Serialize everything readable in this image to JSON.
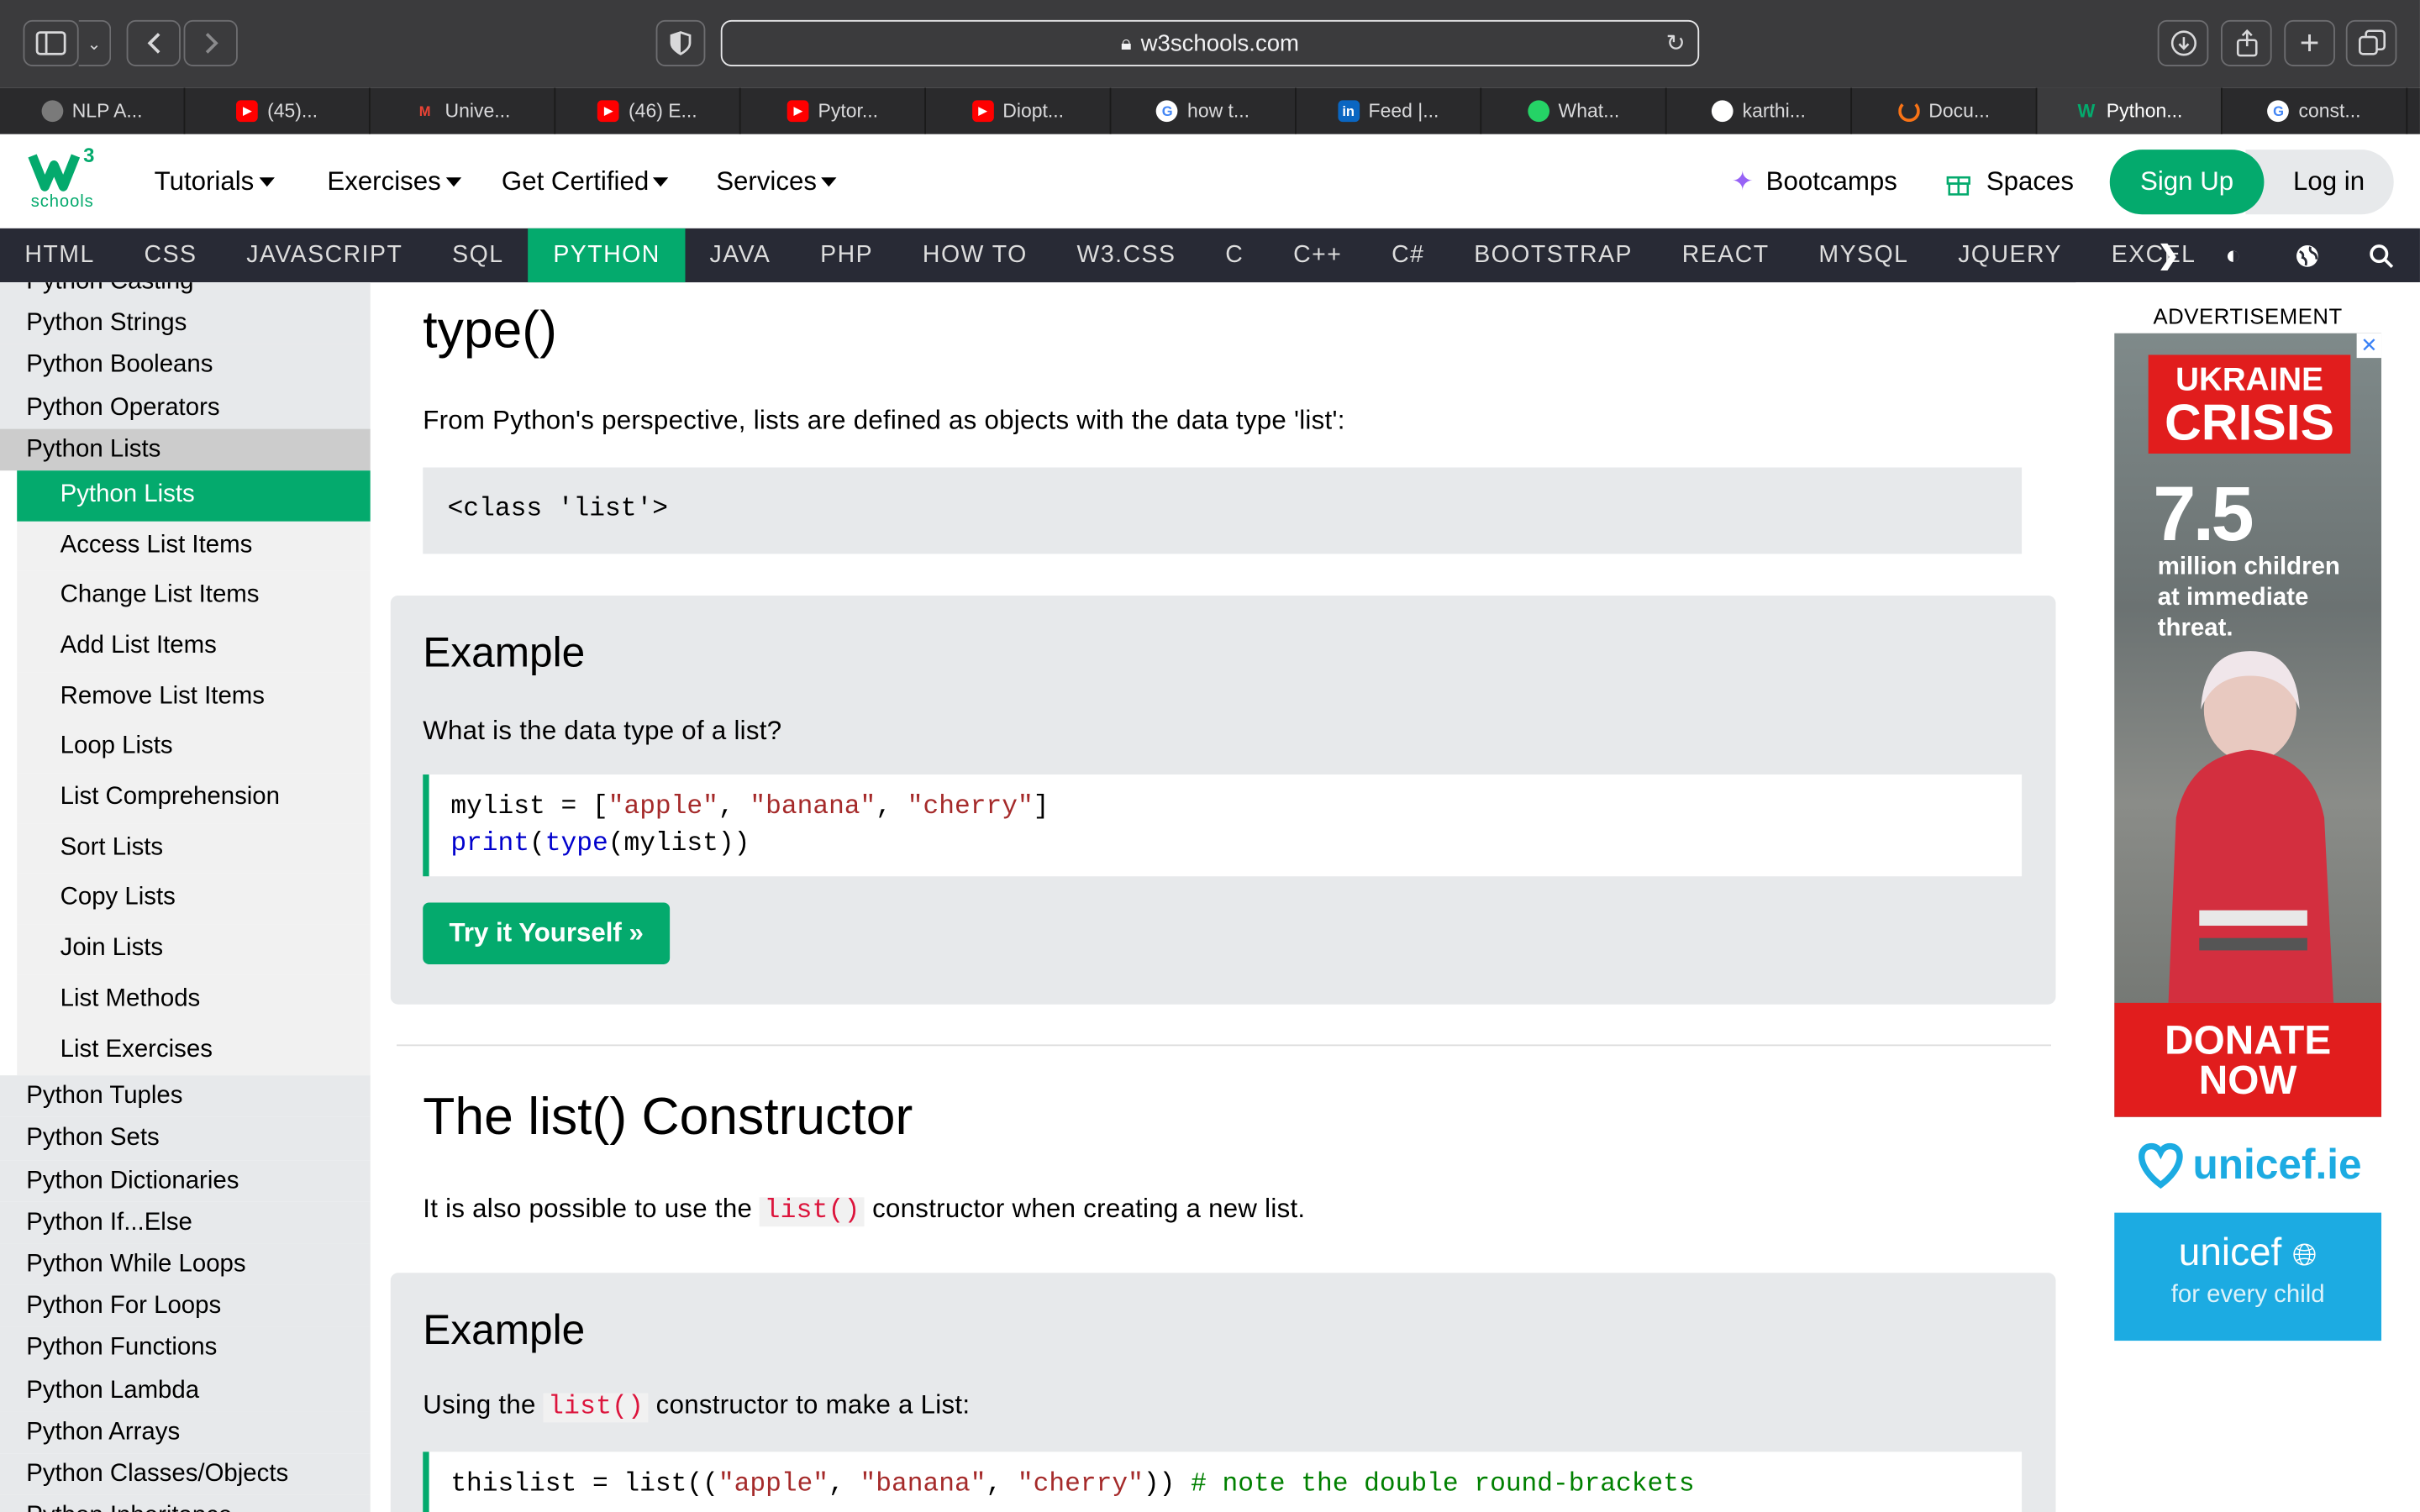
{
  "browser": {
    "url": "w3schools.com",
    "tabs": [
      {
        "title": "NLP A...",
        "icon": "openai-icon",
        "color": "#7a7a7a"
      },
      {
        "title": "(45)...",
        "icon": "youtube-icon",
        "color": "#ff0000"
      },
      {
        "title": "Unive...",
        "icon": "gmail-icon",
        "color": "#ea4335"
      },
      {
        "title": "(46) E...",
        "icon": "youtube-icon",
        "color": "#ff0000"
      },
      {
        "title": "Pytor...",
        "icon": "youtube-icon",
        "color": "#ff0000"
      },
      {
        "title": "Diopt...",
        "icon": "youtube-icon",
        "color": "#ff0000"
      },
      {
        "title": "how t...",
        "icon": "google-icon",
        "color": "#ffffff"
      },
      {
        "title": "Feed |...",
        "icon": "linkedin-icon",
        "color": "#0a66c2"
      },
      {
        "title": "What...",
        "icon": "whatsapp-icon",
        "color": "#25d366"
      },
      {
        "title": "karthi...",
        "icon": "github-icon",
        "color": "#ffffff"
      },
      {
        "title": "Docu...",
        "icon": "loading-icon",
        "color": "#f97316"
      },
      {
        "title": "Python...",
        "icon": "w3schools-icon",
        "color": "#04aa6d"
      },
      {
        "title": "const...",
        "icon": "google-icon",
        "color": "#ffffff"
      }
    ],
    "active_tab": 11
  },
  "header": {
    "logo_text": "schools",
    "logo_sup": "3",
    "menus": [
      "Tutorials",
      "Exercises",
      "Get Certified",
      "Services"
    ],
    "bootcamps": "Bootcamps",
    "spaces": "Spaces",
    "signup": "Sign Up",
    "login": "Log in"
  },
  "langbar": [
    "HTML",
    "CSS",
    "JAVASCRIPT",
    "SQL",
    "PYTHON",
    "JAVA",
    "PHP",
    "HOW TO",
    "W3.CSS",
    "C",
    "C++",
    "C#",
    "BOOTSTRAP",
    "REACT",
    "MYSQL",
    "JQUERY",
    "EXCEL"
  ],
  "sidebar": {
    "top_items": [
      "Python Casting",
      "Python Strings",
      "Python Booleans",
      "Python Operators",
      "Python Lists"
    ],
    "children": [
      "Python Lists",
      "Access List Items",
      "Change List Items",
      "Add List Items",
      "Remove List Items",
      "Loop Lists",
      "List Comprehension",
      "Sort Lists",
      "Copy Lists",
      "Join Lists",
      "List Methods",
      "List Exercises"
    ],
    "bottom_items": [
      "Python Tuples",
      "Python Sets",
      "Python Dictionaries",
      "Python If...Else",
      "Python While Loops",
      "Python For Loops",
      "Python Functions",
      "Python Lambda",
      "Python Arrays",
      "Python Classes/Objects",
      "Python Inheritance"
    ]
  },
  "main": {
    "h1": "type()",
    "p1": "From Python's perspective, lists are defined as objects with the data type 'list':",
    "output": "<class 'list'>",
    "example1": {
      "heading": "Example",
      "question": "What is the data type of a list?",
      "code_l1_a": "mylist = [",
      "code_l1_s1": "\"apple\"",
      "code_l1_sep": ", ",
      "code_l1_s2": "\"banana\"",
      "code_l1_s3": "\"cherry\"",
      "code_l1_end": "]",
      "code_l2_kw1": "print",
      "code_l2_p1": "(",
      "code_l2_kw2": "type",
      "code_l2_rest": "(mylist))",
      "button": "Try it Yourself »"
    },
    "h2": "The list() Constructor",
    "p2_before": "It is also possible to use the",
    "p2_code": "list()",
    "p2_after": "constructor when creating a new list.",
    "example2": {
      "heading": "Example",
      "p_before": "Using the",
      "p_code": "list()",
      "p_after": "constructor to make a List:",
      "code_a": "thislist = list((",
      "code_s1": "\"apple\"",
      "code_sep": ", ",
      "code_s2": "\"banana\"",
      "code_s3": "\"cherry\"",
      "code_end": ")) ",
      "code_comment": "# note the double round-brackets"
    }
  },
  "ad": {
    "label": "ADVERTISEMENT",
    "banner_l1": "UKRAINE",
    "banner_l2": "CRISIS",
    "stat": "7.5",
    "stat_text": "million children at immediate threat.",
    "donate_l1": "DONATE",
    "donate_l2": "NOW",
    "unicef_domain": "unicef.ie",
    "unicef_name": "unicef",
    "unicef_tagline": "for every child"
  }
}
